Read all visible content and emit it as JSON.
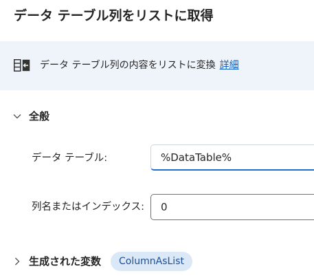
{
  "dialog": {
    "title": "データ テーブル列をリストに取得"
  },
  "banner": {
    "icon": "table-to-list-icon",
    "description": "データ テーブル列の内容をリストに変換",
    "link_label": "詳細"
  },
  "general_section": {
    "label": "全般",
    "expanded": true
  },
  "fields": {
    "data_table": {
      "label": "データ テーブル:",
      "value": "%DataTable%"
    },
    "column": {
      "label": "列名またはインデックス:",
      "value": "0"
    }
  },
  "variables_section": {
    "label": "生成された変数",
    "expanded": false,
    "variable_name": "ColumnAsList"
  },
  "colors": {
    "accent": "#1f6fd1",
    "link": "#0f5cc0",
    "banner_bg": "#eff4fb",
    "badge_bg": "#dbe8f7"
  }
}
